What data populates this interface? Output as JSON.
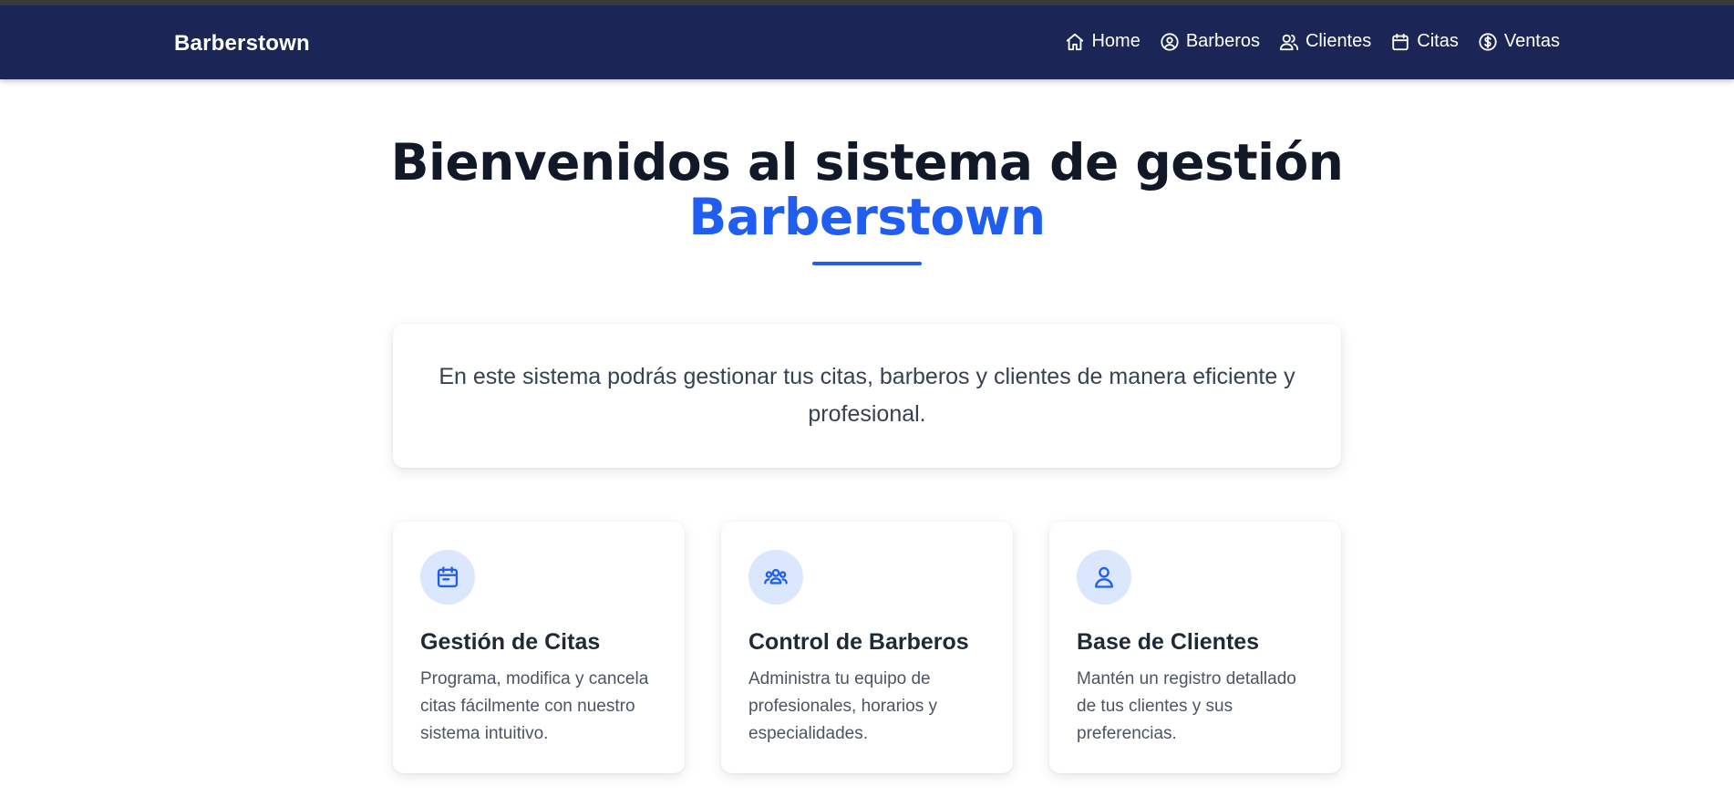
{
  "navbar": {
    "brand": "Barberstown",
    "links": [
      {
        "label": "Home",
        "icon": "home-icon"
      },
      {
        "label": "Barberos",
        "icon": "user-circle-icon"
      },
      {
        "label": "Clientes",
        "icon": "users-icon"
      },
      {
        "label": "Citas",
        "icon": "calendar-icon"
      },
      {
        "label": "Ventas",
        "icon": "dollar-circle-icon"
      }
    ]
  },
  "hero": {
    "title_line1": "Bienvenidos al sistema de gestión",
    "title_line2": "Barberstown"
  },
  "intro": {
    "text": "En este sistema podrás gestionar tus citas, barberos y clientes de manera eficiente y profesional."
  },
  "features": [
    {
      "icon": "calendar-icon",
      "title": "Gestión de Citas",
      "description": "Programa, modifica y cancela citas fácilmente con nuestro sistema intuitivo."
    },
    {
      "icon": "user-group-icon",
      "title": "Control de Barberos",
      "description": "Administra tu equipo de profesionales, horarios y especialidades."
    },
    {
      "icon": "user-icon",
      "title": "Base de Clientes",
      "description": "Mantén un registro detallado de tus clientes y sus preferencias."
    }
  ],
  "colors": {
    "navbar_bg": "#1b2656",
    "accent": "#1f5ef0",
    "icon_circle_bg": "#dbe7fd",
    "heading": "#111827"
  }
}
